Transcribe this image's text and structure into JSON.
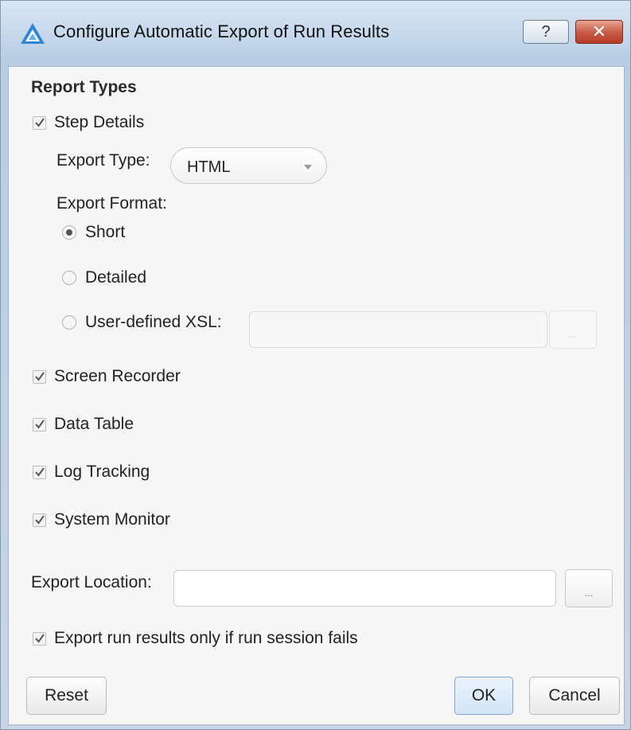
{
  "window": {
    "title": "Configure Automatic Export of Run Results",
    "help_label": "?",
    "close_label": "✕"
  },
  "report_types": {
    "heading": "Report Types",
    "step_details": {
      "label": "Step Details",
      "checked": true
    },
    "export_type": {
      "label": "Export Type:",
      "value": "HTML"
    },
    "export_format": {
      "label": "Export Format:",
      "options": [
        {
          "label": "Short",
          "selected": true
        },
        {
          "label": "Detailed",
          "selected": false
        },
        {
          "label": "User-defined XSL:",
          "selected": false
        }
      ],
      "xsl_path_value": "",
      "xsl_browse_label": "..."
    },
    "screen_recorder": {
      "label": "Screen Recorder",
      "checked": true
    },
    "data_table": {
      "label": "Data Table",
      "checked": true
    },
    "log_tracking": {
      "label": "Log Tracking",
      "checked": true
    },
    "system_monitor": {
      "label": "System Monitor",
      "checked": true
    }
  },
  "export_location": {
    "label": "Export Location:",
    "value": "",
    "browse_label": "..."
  },
  "only_if_fails": {
    "label": "Export run results only if run session fails",
    "checked": true
  },
  "buttons": {
    "reset": "Reset",
    "ok": "OK",
    "cancel": "Cancel"
  },
  "colors": {
    "title_bar": "#c8d9ec",
    "close_button": "#c75a45",
    "ok_button": "#d3e5f6"
  }
}
